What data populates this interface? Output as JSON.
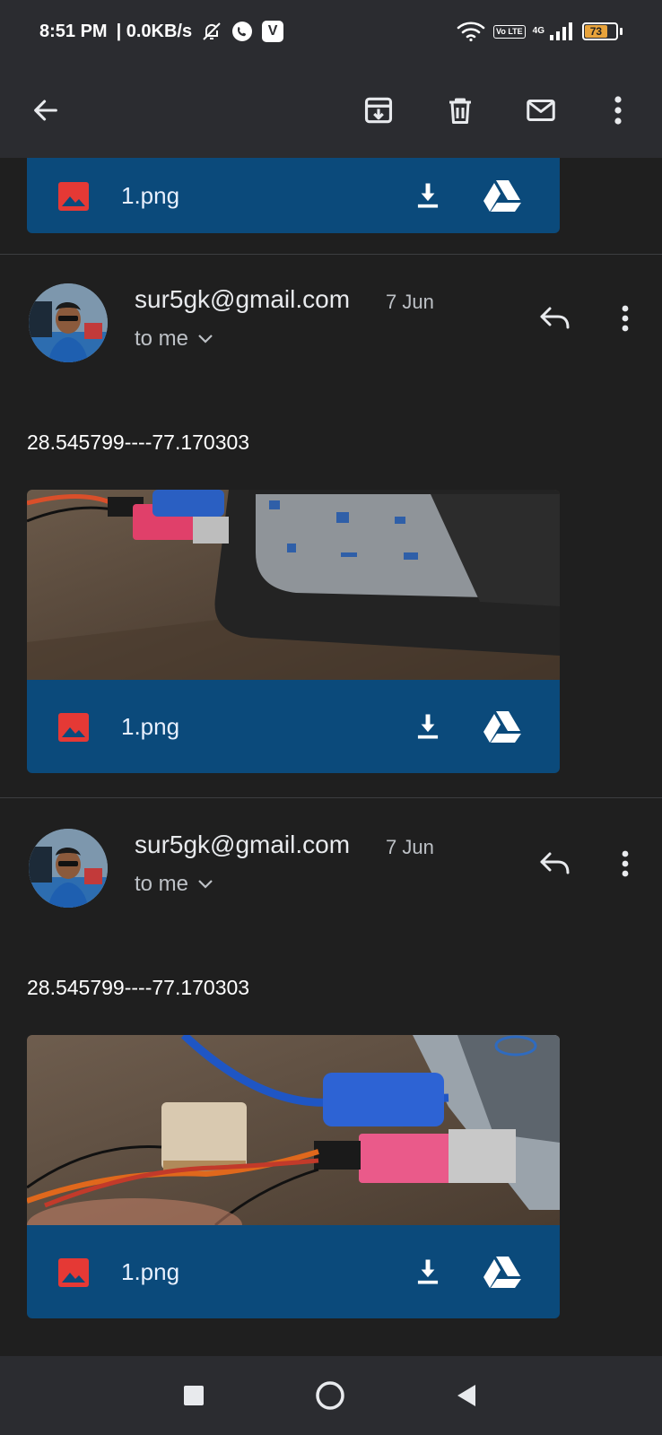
{
  "status_bar": {
    "time": "8:51 PM",
    "speed": "| 0.0KB/s",
    "vpn_badge": "V",
    "volte": "Vo LTE",
    "network": "4G",
    "battery": "73",
    "battery_level": 0.73,
    "icons": [
      "mute-bell-icon",
      "whatsapp-icon",
      "vpn-icon",
      "wifi-icon",
      "volte-icon",
      "signal-icon",
      "battery-icon"
    ]
  },
  "action_bar": {
    "icons": [
      "back-arrow-icon",
      "archive-icon",
      "delete-icon",
      "mark-unread-icon",
      "more-vert-icon"
    ]
  },
  "attachment_top": {
    "name": "1.png"
  },
  "messages": [
    {
      "sender": "sur5gk@gmail.com",
      "date": "7 Jun",
      "recipient": "to me",
      "body": "28.545799----77.170303",
      "attachment_name": "1.png"
    },
    {
      "sender": "sur5gk@gmail.com",
      "date": "7 Jun",
      "recipient": "to me",
      "body": "28.545799----77.170303",
      "attachment_name": "1.png"
    }
  ],
  "colors": {
    "background": "#1f1f1f",
    "bar": "#2b2c30",
    "attachment": "#0b4a7b",
    "image_icon": "#e53935",
    "battery": "#e8a33b"
  },
  "nav_bar": {
    "icons": [
      "recents-square-icon",
      "home-circle-icon",
      "back-triangle-icon"
    ]
  }
}
